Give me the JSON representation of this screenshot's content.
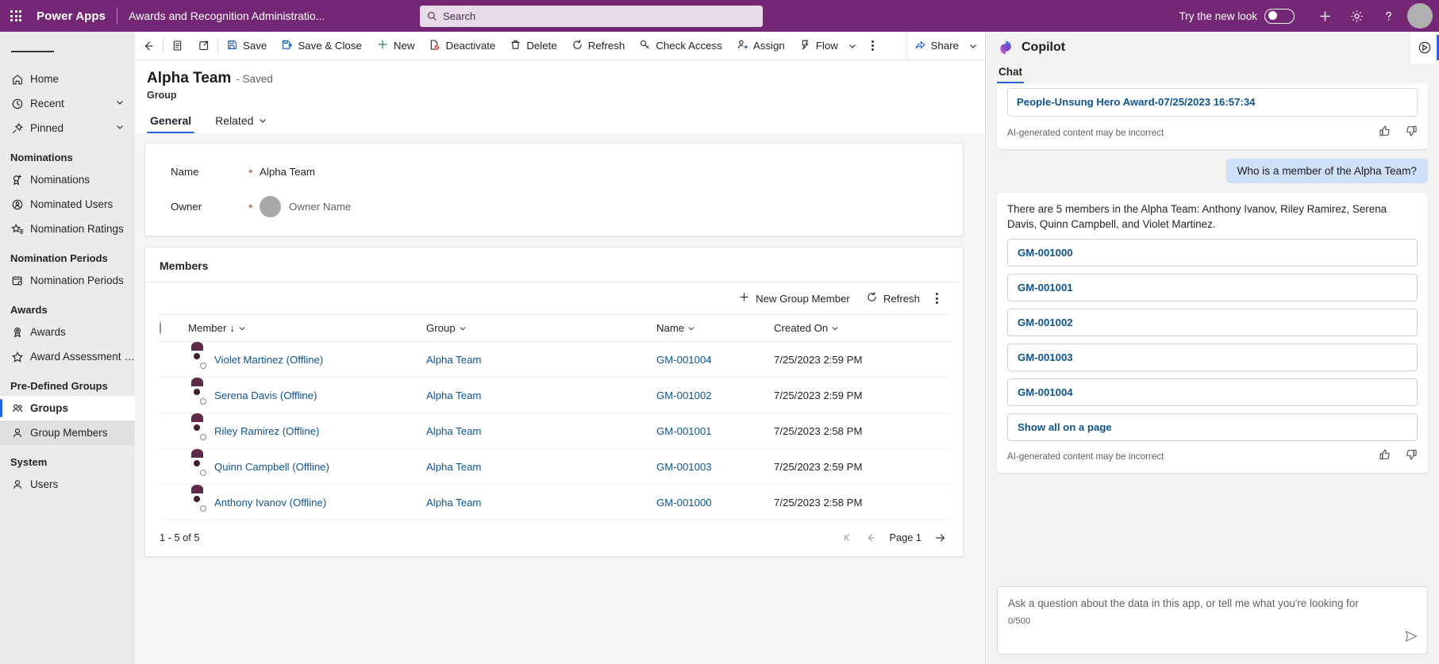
{
  "topbar": {
    "waffle_label": "app-launcher",
    "brand": "Power Apps",
    "app_name": "Awards and Recognition Administratio...",
    "search_placeholder": "Search",
    "search_value": "",
    "new_look_label": "Try the new look",
    "new_look_state": "off",
    "accent_color": "#742774"
  },
  "sidebar": {
    "top_items": [
      {
        "label": "Home",
        "icon": "home-icon",
        "expandable": false
      },
      {
        "label": "Recent",
        "icon": "clock-icon",
        "expandable": true
      },
      {
        "label": "Pinned",
        "icon": "pin-icon",
        "expandable": true
      }
    ],
    "groups": [
      {
        "title": "Nominations",
        "items": [
          {
            "label": "Nominations",
            "icon": "ribbon-add-icon"
          },
          {
            "label": "Nominated Users",
            "icon": "person-badge-icon"
          },
          {
            "label": "Nomination Ratings",
            "icon": "star-list-icon"
          }
        ]
      },
      {
        "title": "Nomination Periods",
        "items": [
          {
            "label": "Nomination Periods",
            "icon": "calendar-clock-icon"
          }
        ]
      },
      {
        "title": "Awards",
        "items": [
          {
            "label": "Awards",
            "icon": "award-medal-icon"
          },
          {
            "label": "Award Assessment R...",
            "icon": "star-icon"
          }
        ]
      },
      {
        "title": "Pre-Defined Groups",
        "items": [
          {
            "label": "Groups",
            "icon": "people-icon",
            "selected": true
          },
          {
            "label": "Group Members",
            "icon": "person-icon",
            "hovered": true
          }
        ]
      },
      {
        "title": "System",
        "items": [
          {
            "label": "Users",
            "icon": "person-icon"
          }
        ]
      }
    ]
  },
  "commandbar": {
    "back_label": "Back",
    "form_selector_label": "Form selector",
    "popout_label": "Open in new window",
    "items": [
      {
        "label": "Save",
        "icon": "save-icon"
      },
      {
        "label": "Save & Close",
        "icon": "save-close-icon"
      },
      {
        "label": "New",
        "icon": "plus-icon"
      },
      {
        "label": "Deactivate",
        "icon": "deactivate-icon"
      },
      {
        "label": "Delete",
        "icon": "trash-icon"
      },
      {
        "label": "Refresh",
        "icon": "refresh-icon"
      },
      {
        "label": "Check Access",
        "icon": "key-icon"
      },
      {
        "label": "Assign",
        "icon": "assign-person-icon"
      },
      {
        "label": "Flow",
        "icon": "flow-icon",
        "has_chevron": true
      }
    ],
    "overflow_label": "More commands",
    "share_label": "Share"
  },
  "record": {
    "title": "Alpha Team",
    "status": "- Saved",
    "entity": "Group",
    "tabs": [
      {
        "label": "General",
        "active": true,
        "has_chevron": false
      },
      {
        "label": "Related",
        "active": false,
        "has_chevron": true
      }
    ]
  },
  "form": {
    "fields": [
      {
        "label": "Name",
        "required": "*",
        "value": "Alpha Team",
        "type": "text"
      },
      {
        "label": "Owner",
        "required": "*",
        "value": "Owner Name",
        "type": "lookup-avatar"
      }
    ]
  },
  "subgrid": {
    "title": "Members",
    "toolbar": [
      {
        "label": "New Group Member",
        "icon": "plus-icon"
      },
      {
        "label": "Refresh",
        "icon": "refresh-icon"
      }
    ],
    "overflow_label": "More grid commands",
    "columns": [
      {
        "label": "Member",
        "sorted": "↓",
        "has_chevron": true
      },
      {
        "label": "Group",
        "has_chevron": true
      },
      {
        "label": "Name",
        "has_chevron": true
      },
      {
        "label": "Created On",
        "has_chevron": true
      }
    ],
    "rows": [
      {
        "member": "Violet Martinez (Offline)",
        "group": "Alpha Team",
        "name": "GM-001004",
        "created_on": "7/25/2023 2:59 PM"
      },
      {
        "member": "Serena Davis (Offline)",
        "group": "Alpha Team",
        "name": "GM-001002",
        "created_on": "7/25/2023 2:59 PM"
      },
      {
        "member": "Riley Ramirez (Offline)",
        "group": "Alpha Team",
        "name": "GM-001001",
        "created_on": "7/25/2023 2:58 PM"
      },
      {
        "member": "Quinn Campbell (Offline)",
        "group": "Alpha Team",
        "name": "GM-001003",
        "created_on": "7/25/2023 2:59 PM"
      },
      {
        "member": "Anthony Ivanov (Offline)",
        "group": "Alpha Team",
        "name": "GM-001000",
        "created_on": "7/25/2023 2:58 PM"
      }
    ],
    "footer_count": "1 - 5 of 5",
    "page_label": "Page 1"
  },
  "copilot": {
    "title": "Copilot",
    "refresh_label": "Refresh chat",
    "close_label": "Close",
    "rail_label": "Copilot rail",
    "tabs": [
      {
        "label": "Chat",
        "active": true
      }
    ],
    "messages": [
      {
        "role": "assistant",
        "clipped": true,
        "link_card": "People-Unsung Hero Award-07/25/2023 16:57:34",
        "disclaimer": "AI-generated content may be incorrect"
      },
      {
        "role": "user",
        "text": "Who is a member of the Alpha Team?"
      },
      {
        "role": "assistant",
        "text": "There are 5 members in the Alpha Team: Anthony Ivanov, Riley Ramirez, Serena Davis, Quinn Campbell, and Violet Martinez.",
        "options": [
          "GM-001000",
          "GM-001001",
          "GM-001002",
          "GM-001003",
          "GM-001004",
          "Show all on a page"
        ],
        "disclaimer": "AI-generated content may be incorrect"
      }
    ],
    "input_placeholder": "Ask a question about the data in this app, or tell me what you're looking for",
    "input_value": "",
    "char_count": "0/500",
    "send_label": "Send"
  }
}
